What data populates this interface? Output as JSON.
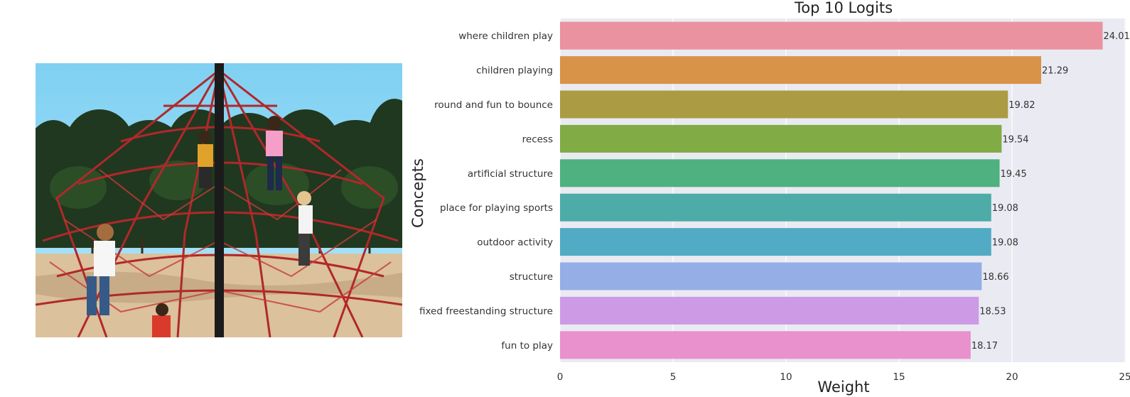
{
  "chart_data": {
    "type": "bar",
    "orientation": "horizontal",
    "title": "Top 10 Logits",
    "xlabel": "Weight",
    "ylabel": "Concepts",
    "xlim": [
      0,
      25
    ],
    "xticks": [
      0,
      5,
      10,
      15,
      20,
      25
    ],
    "grid": true,
    "legend": "none",
    "categories": [
      "where children play",
      "children playing",
      "round and fun to bounce",
      "recess",
      "artificial structure",
      "place for playing sports",
      "outdoor activity",
      "structure",
      "fixed freestanding structure",
      "fun to play"
    ],
    "values": [
      24.01,
      21.29,
      19.82,
      19.54,
      19.45,
      19.08,
      19.08,
      18.66,
      18.53,
      18.17
    ],
    "colors": [
      "#ea929f",
      "#d89348",
      "#ab9b43",
      "#81ab45",
      "#4fb080",
      "#4daca8",
      "#52abc4",
      "#95aee6",
      "#cd9be6",
      "#e891cc"
    ],
    "plot_background": "#eaeaf2"
  },
  "image": {
    "icon": "playground-rope-climbing-structure-photo"
  }
}
